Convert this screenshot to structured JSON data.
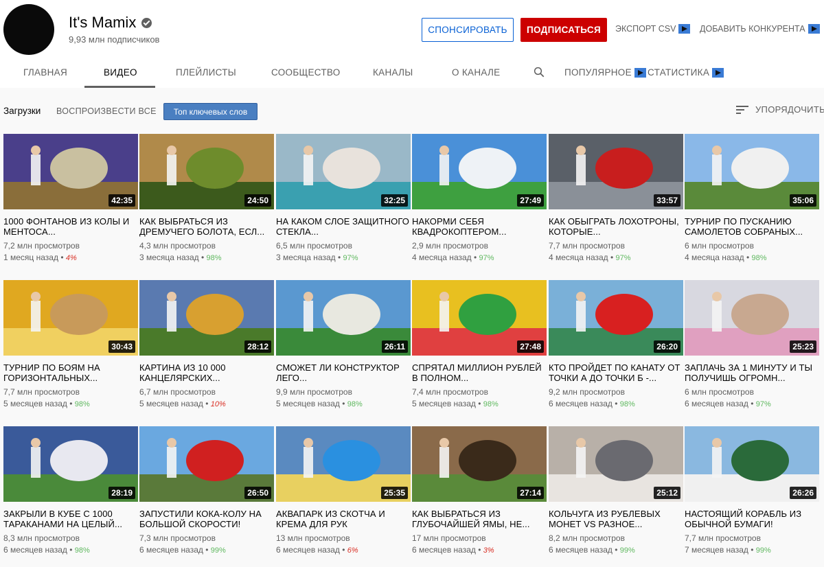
{
  "channel": {
    "name": "It's Mamix",
    "subscribers": "9,93 млн подписчиков"
  },
  "actions": {
    "sponsor": "СПОНСИРОВАТЬ",
    "subscribe": "ПОДПИСАТЬСЯ",
    "export_csv": "ЭКСПОРТ CSV",
    "add_competitor": "ДОБАВИТЬ КОНКУРЕНТА"
  },
  "tabs": {
    "home": "ГЛАВНАЯ",
    "videos": "ВИДЕО",
    "playlists": "ПЛЕЙЛИСТЫ",
    "community": "СООБЩЕСТВО",
    "channels": "КАНАЛЫ",
    "about": "О КАНАЛЕ",
    "popular": "ПОПУЛЯРНОЕ",
    "stats": "СТАТИСТИКА"
  },
  "toolbar": {
    "uploads": "Загрузки",
    "play_all": "ВОСПРОИЗВЕСТИ ВСЕ",
    "keywords": "Топ ключевых слов",
    "sort": "УПОРЯДОЧИТЬ"
  },
  "videos": [
    {
      "duration": "42:35",
      "title": "1000 ФОНТАНОВ ИЗ КОЛЫ И МЕНТОСА...",
      "views": "7,2 млн просмотров",
      "age": "1 месяц назад",
      "pct": "4%",
      "pct_state": "bad",
      "colors": [
        "#4a3f8a",
        "#c9c0a0",
        "#8a6e3a"
      ]
    },
    {
      "duration": "24:50",
      "title": "КАК ВЫБРАТЬСЯ ИЗ ДРЕМУЧЕГО БОЛОТА, ЕСЛ...",
      "views": "4,3 млн просмотров",
      "age": "3 месяца назад",
      "pct": "98%",
      "pct_state": "good",
      "colors": [
        "#b08a4a",
        "#6e8c2c",
        "#3c5a1c"
      ]
    },
    {
      "duration": "32:25",
      "title": "НА КАКОМ СЛОЕ ЗАЩИТНОГО СТЕКЛА...",
      "views": "6,5 млн просмотров",
      "age": "3 месяца назад",
      "pct": "97%",
      "pct_state": "good",
      "colors": [
        "#9ab8c8",
        "#e8e2dc",
        "#3aa0b0"
      ]
    },
    {
      "duration": "27:49",
      "title": "НАКОРМИ СЕБЯ КВАДРОКОПТЕРОМ...",
      "views": "2,9 млн просмотров",
      "age": "4 месяца назад",
      "pct": "97%",
      "pct_state": "good",
      "colors": [
        "#4a90d8",
        "#eef2f6",
        "#3ea040"
      ]
    },
    {
      "duration": "33:57",
      "title": "КАК ОБЫГРАТЬ ЛОХОТРОНЫ, КОТОРЫЕ...",
      "views": "7,7 млн просмотров",
      "age": "4 месяца назад",
      "pct": "97%",
      "pct_state": "good",
      "colors": [
        "#5a6068",
        "#c81e1e",
        "#8a9098"
      ]
    },
    {
      "duration": "35:06",
      "title": "ТУРНИР ПО ПУСКАНИЮ САМОЛЕТОВ СОБРАНЫХ...",
      "views": "6 млн просмотров",
      "age": "4 месяца назад",
      "pct": "98%",
      "pct_state": "good",
      "colors": [
        "#8ab8e8",
        "#f0f0f0",
        "#5a8a3a"
      ]
    },
    {
      "duration": "30:43",
      "title": "ТУРНИР ПО БОЯМ НА ГОРИЗОНТАЛЬНЫХ...",
      "views": "7,7 млн просмотров",
      "age": "5 месяцев назад",
      "pct": "98%",
      "pct_state": "good",
      "colors": [
        "#e0a820",
        "#c89a5a",
        "#f0d060"
      ]
    },
    {
      "duration": "28:12",
      "title": "КАРТИНА ИЗ 10 000 КАНЦЕЛЯРСКИХ...",
      "views": "6,7 млн просмотров",
      "age": "5 месяцев назад",
      "pct": "10%",
      "pct_state": "bad",
      "colors": [
        "#5a7ab0",
        "#d8a030",
        "#4a7a2a"
      ]
    },
    {
      "duration": "26:11",
      "title": "СМОЖЕТ ЛИ КОНСТРУКТОР ЛЕГО...",
      "views": "9,9 млн просмотров",
      "age": "5 месяцев назад",
      "pct": "98%",
      "pct_state": "good",
      "colors": [
        "#5a98d0",
        "#e8e8e0",
        "#3a8a3a"
      ]
    },
    {
      "duration": "27:48",
      "title": "СПРЯТАЛ МИЛЛИОН РУБЛЕЙ В ПОЛНОМ...",
      "views": "7,4 млн просмотров",
      "age": "5 месяцев назад",
      "pct": "98%",
      "pct_state": "good",
      "colors": [
        "#e8c020",
        "#30a040",
        "#e04040"
      ]
    },
    {
      "duration": "26:20",
      "title": "КТО ПРОЙДЕТ ПО КАНАТУ ОТ ТОЧКИ А ДО ТОЧКИ Б -...",
      "views": "9,2 млн просмотров",
      "age": "6 месяцев назад",
      "pct": "98%",
      "pct_state": "good",
      "colors": [
        "#7ab0d8",
        "#d82020",
        "#3a8a5a"
      ]
    },
    {
      "duration": "25:23",
      "title": "ЗАПЛАЧЬ ЗА 1 МИНУТУ И ТЫ ПОЛУЧИШЬ ОГРОМН...",
      "views": "6 млн просмотров",
      "age": "6 месяцев назад",
      "pct": "97%",
      "pct_state": "good",
      "colors": [
        "#d8d8e0",
        "#c8a890",
        "#e0a0c0"
      ]
    },
    {
      "duration": "28:19",
      "title": "ЗАКРЫЛИ В КУБЕ С 1000 ТАРАКАНАМИ НА ЦЕЛЫЙ...",
      "views": "8,3 млн просмотров",
      "age": "6 месяцев назад",
      "pct": "98%",
      "pct_state": "good",
      "colors": [
        "#3a5a9a",
        "#e8e8f0",
        "#4a8a3a"
      ]
    },
    {
      "duration": "26:50",
      "title": "ЗАПУСТИЛИ КОКА-КОЛУ НА БОЛЬШОЙ СКОРОСТИ!",
      "views": "7,3 млн просмотров",
      "age": "6 месяцев назад",
      "pct": "99%",
      "pct_state": "good",
      "colors": [
        "#6aa8e0",
        "#d02020",
        "#5a7a3a"
      ]
    },
    {
      "duration": "25:35",
      "title": "АКВАПАРК ИЗ СКОТЧА И КРЕМА ДЛЯ РУК",
      "views": "13 млн просмотров",
      "age": "6 месяцев назад",
      "pct": "6%",
      "pct_state": "bad",
      "colors": [
        "#5a8ac0",
        "#2a90e0",
        "#e8d060"
      ]
    },
    {
      "duration": "27:14",
      "title": "КАК ВЫБРАТЬСЯ ИЗ ГЛУБОЧАЙШЕЙ ЯМЫ, НЕ...",
      "views": "17 млн просмотров",
      "age": "6 месяцев назад",
      "pct": "3%",
      "pct_state": "bad",
      "colors": [
        "#8a6a4a",
        "#3a2a1a",
        "#5a8a3a"
      ]
    },
    {
      "duration": "25:12",
      "title": "КОЛЬЧУГА ИЗ РУБЛЕВЫХ МОНЕТ VS РАЗНОЕ...",
      "views": "8,2 млн просмотров",
      "age": "6 месяцев назад",
      "pct": "99%",
      "pct_state": "good",
      "colors": [
        "#b8b0a8",
        "#6a6a70",
        "#e8e4e0"
      ]
    },
    {
      "duration": "26:26",
      "title": "НАСТОЯЩИЙ КОРАБЛЬ ИЗ ОБЫЧНОЙ БУМАГИ!",
      "views": "7,7 млн просмотров",
      "age": "7 месяцев назад",
      "pct": "99%",
      "pct_state": "good",
      "colors": [
        "#8ab8e0",
        "#2a6a3a",
        "#f0f0f0"
      ]
    }
  ]
}
